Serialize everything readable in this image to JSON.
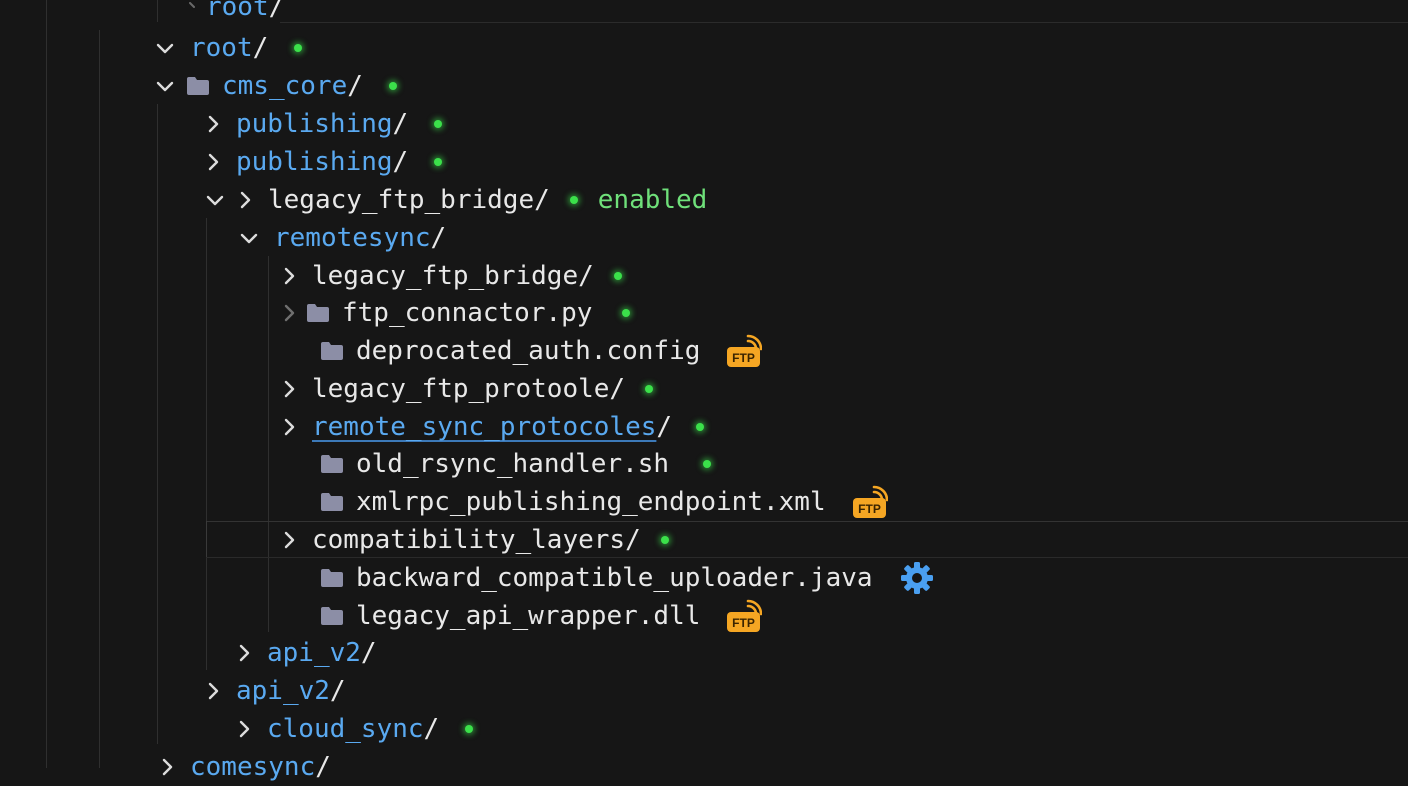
{
  "tree": {
    "rows": [
      {
        "name": "root",
        "slash": "/"
      },
      {
        "name": "root",
        "slash": "/"
      },
      {
        "name": "cms_core",
        "slash": "/"
      },
      {
        "name": "publishing",
        "slash": "/"
      },
      {
        "name": "publishing",
        "slash": "/"
      },
      {
        "name": "legacy_ftp_bridge",
        "slash": "/",
        "status": "enabled"
      },
      {
        "name": "remotesync",
        "slash": "/"
      },
      {
        "name": "legacy_ftp_bridge",
        "slash": "/"
      },
      {
        "name": "ftp_connactor.py"
      },
      {
        "name": "deprocated_auth.config",
        "badge": "FTP"
      },
      {
        "name": "legacy_ftp_protoole",
        "slash": "/"
      },
      {
        "name": "remote_sync_protocoles",
        "slash": "/"
      },
      {
        "name": "old_rsync_handler.sh"
      },
      {
        "name": "xmlrpc_publishing_endpoint.xml",
        "badge": "FTP"
      },
      {
        "name": "compatibility_layers",
        "slash": "/"
      },
      {
        "name": "backward_compatible_uploader.java"
      },
      {
        "name": "legacy_api_wrapper.dll",
        "badge": "FTP"
      },
      {
        "name": "api_v2",
        "slash": "/"
      },
      {
        "name": "api_v2",
        "slash": "/"
      },
      {
        "name": "cloud_sync",
        "slash": "/"
      },
      {
        "name": "comesync",
        "slash": "/"
      }
    ]
  },
  "colors": {
    "background": "#161616",
    "folder_blue": "#5aa9f0",
    "status_dot": "#3be04a",
    "status_text": "#6fe07a",
    "ftp_badge": "#f5a623",
    "gear": "#4a9ff0"
  }
}
